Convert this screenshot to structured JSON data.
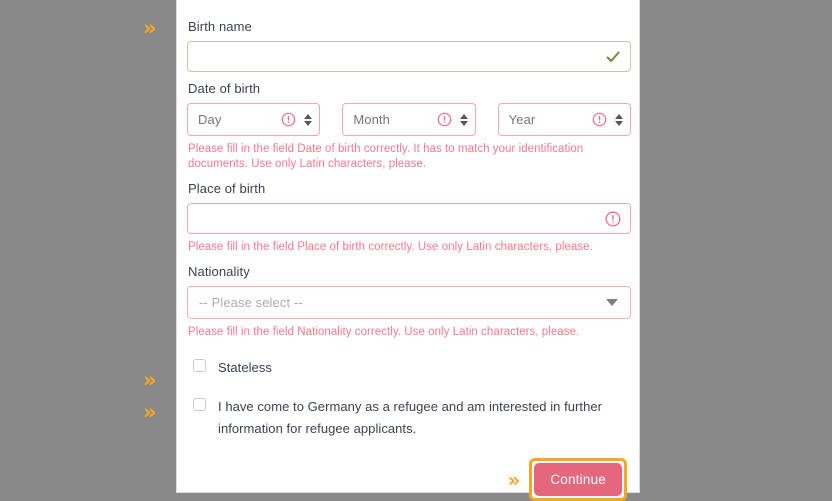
{
  "colors": {
    "page_background": "#898989",
    "card_background": "#ffffff",
    "label_text": "#3a4250",
    "error_text": "#f4798b",
    "error_border": "#f3a8b0",
    "valid_border": "#c2c7a8",
    "valid_check": "#6f8c31",
    "accent_orange": "#f5a623",
    "button_pink": "#e4677d"
  },
  "form": {
    "birth_name": {
      "label": "Birth name",
      "value": "",
      "placeholder": "",
      "state": "valid",
      "icon": "check-icon"
    },
    "date_of_birth": {
      "label": "Date of birth",
      "fields": [
        {
          "name": "day",
          "placeholder": "Day",
          "value": "",
          "icon": "warning-circle-icon"
        },
        {
          "name": "month",
          "placeholder": "Month",
          "value": "",
          "icon": "warning-circle-icon"
        },
        {
          "name": "year",
          "placeholder": "Year",
          "value": "",
          "icon": "warning-circle-icon"
        }
      ],
      "error": "Please fill in the field Date of birth correctly. It has to match your identification documents. Use only Latin characters, please."
    },
    "place_of_birth": {
      "label": "Place of birth",
      "value": "",
      "placeholder": "",
      "state": "error",
      "icon": "warning-circle-icon",
      "error": "Please fill in the field Place of birth correctly. Use only Latin characters, please."
    },
    "nationality": {
      "label": "Nationality",
      "selected": "-- Please select --",
      "state": "error",
      "icon": "chevron-down-icon",
      "error": "Please fill in the field Nationality correctly. Use only Latin characters, please."
    },
    "stateless": {
      "label": "Stateless",
      "checked": false
    },
    "refugee": {
      "label": "I have come to Germany as a refugee and am interested in further information for refugee applicants.",
      "checked": false
    }
  },
  "footer": {
    "continue_label": "Continue",
    "chevron_marker": "»"
  },
  "markers": {
    "top": "»",
    "stateless": "»",
    "refugee": "»"
  }
}
